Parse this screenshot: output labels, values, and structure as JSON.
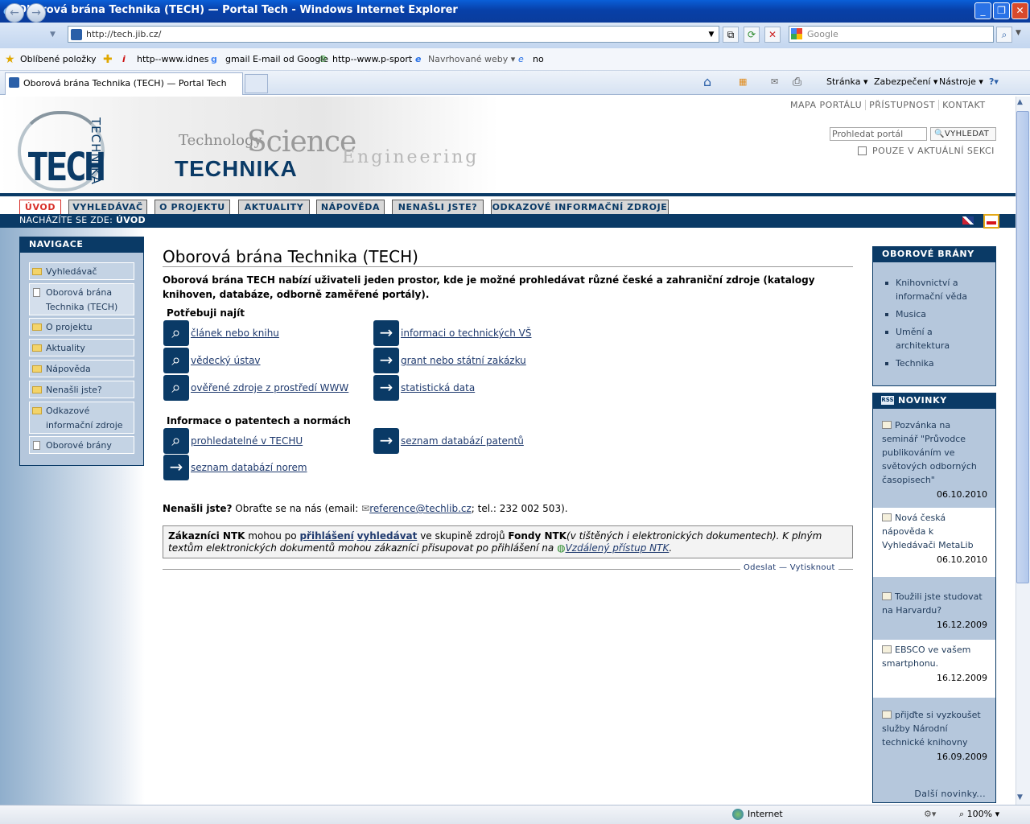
{
  "window": {
    "title": "Oborová brána Technika (TECH) — Portal Tech - Windows Internet Explorer"
  },
  "browser": {
    "address": "http://tech.jib.cz/",
    "search_placeholder": "Google",
    "favorites_label": "Oblíbené položky",
    "favorites": [
      "http--www.idnes",
      "gmail E-mail od Google",
      "http--www.p-sport",
      "Navrhované weby ▾",
      "no"
    ],
    "tab_title": "Oborová brána Technika (TECH) — Portal Tech",
    "commands": [
      "Stránka ▾",
      "Zabezpečení ▾",
      "Nástroje ▾"
    ],
    "status_zone": "Internet",
    "zoom": "100%"
  },
  "header": {
    "logo_text": "TECH",
    "logo_vertical": "TECHNIKA",
    "word_technology": "Technology",
    "word_science": "Science",
    "word_engineering": "Engineering",
    "word_technika": "TECHNIKA",
    "toplinks": [
      "MAPA PORTÁLU",
      "PŘÍSTUPNOST",
      "KONTAKT"
    ],
    "search_placeholder": "Prohledat portál",
    "search_button": "VYHLEDAT",
    "only_section": "POUZE V AKTUÁLNÍ SEKCI"
  },
  "menu": {
    "tabs": [
      "ÚVOD",
      "VYHLEDÁVAČ",
      "O PROJEKTU",
      "AKTUALITY",
      "NÁPOVĚDA",
      "NENAŠLI JSTE?",
      "ODKAZOVÉ INFORMAČNÍ ZDROJE"
    ],
    "crumb_prefix": "NACHÁZÍTE SE ZDE:",
    "crumb_current": "ÚVOD"
  },
  "sidebar": {
    "title": "NAVIGACE",
    "items": [
      "Vyhledávač",
      "Oborová brána Technika (TECH)",
      "O projektu",
      "Aktuality",
      "Nápověda",
      "Nenašli jste?",
      "Odkazové informační zdroje",
      "Oborové brány"
    ]
  },
  "main": {
    "title": "Oborová brána Technika (TECH)",
    "intro": "Oborová brána TECH nabízí uživateli jeden prostor, kde je možné prohledávat různé české a zahraniční zdroje (katalogy knihoven, databáze, odborně zaměřené portály).",
    "section1": "Potřebuji najít",
    "links1_left": [
      "článek nebo knihu",
      "vědecký ústav",
      "ověřené zdroje z prostředí WWW"
    ],
    "links1_right": [
      "informaci o technických VŠ",
      "grant nebo státní zakázku",
      "statistická data"
    ],
    "section2": "Informace o patentech a normách",
    "link_patents_search": "prohledatelné v TECHU",
    "link_patents_db": "seznam databází patentů",
    "link_norms_db": "seznam databází norem",
    "notfound_bold": "Nenašli jste?",
    "notfound_text": " Obraťte se na nás (email: ",
    "notfound_email": "reference@techlib.cz",
    "notfound_tail": "; tel.: 232 002 503).",
    "ntk_1": "Zákazníci NTK",
    "ntk_2": " mohou po ",
    "ntk_login": "přihlášení",
    "ntk_3": " ",
    "ntk_search": "vyhledávat",
    "ntk_4": " ve skupině zdrojů ",
    "ntk_5": "Fondy NTK",
    "ntk_6": "(v tištěných i elektronických dokumentech).  K plným textům elektronických dokumentů mohou zákazníci přisupovat po přihlášení na ",
    "ntk_remote": "Vzdálený přístup NTK",
    "ntk_7": ".",
    "send": "Odeslat",
    "print": "Vytisknout"
  },
  "right": {
    "gates_title": "OBOROVÉ BRÁNY",
    "gates": [
      "Knihovnictví a informační věda",
      "Musica",
      "Umění a architektura",
      "Technika"
    ],
    "news_title": "NOVINKY",
    "rss": "RSS",
    "news": [
      {
        "text": "Pozvánka na seminář \"Průvodce publikováním ve světových odborných časopisech\"",
        "date": "06.10.2010"
      },
      {
        "text": "Nová česká nápověda k Vyhledávači MetaLib",
        "date": "06.10.2010"
      },
      {
        "text": "Toužili jste studovat na Harvardu?",
        "date": "16.12.2009"
      },
      {
        "text": "EBSCO ve vašem smartphonu.",
        "date": "16.12.2009"
      },
      {
        "text": "přijďte si vyzkoušet služby Národní technické knihovny",
        "date": "16.09.2009"
      }
    ],
    "more_news": "Další novinky..."
  },
  "colors": {
    "brand_navy": "#0a3a66",
    "active_tab": "#d8302a",
    "panel": "#b5c7dc"
  }
}
